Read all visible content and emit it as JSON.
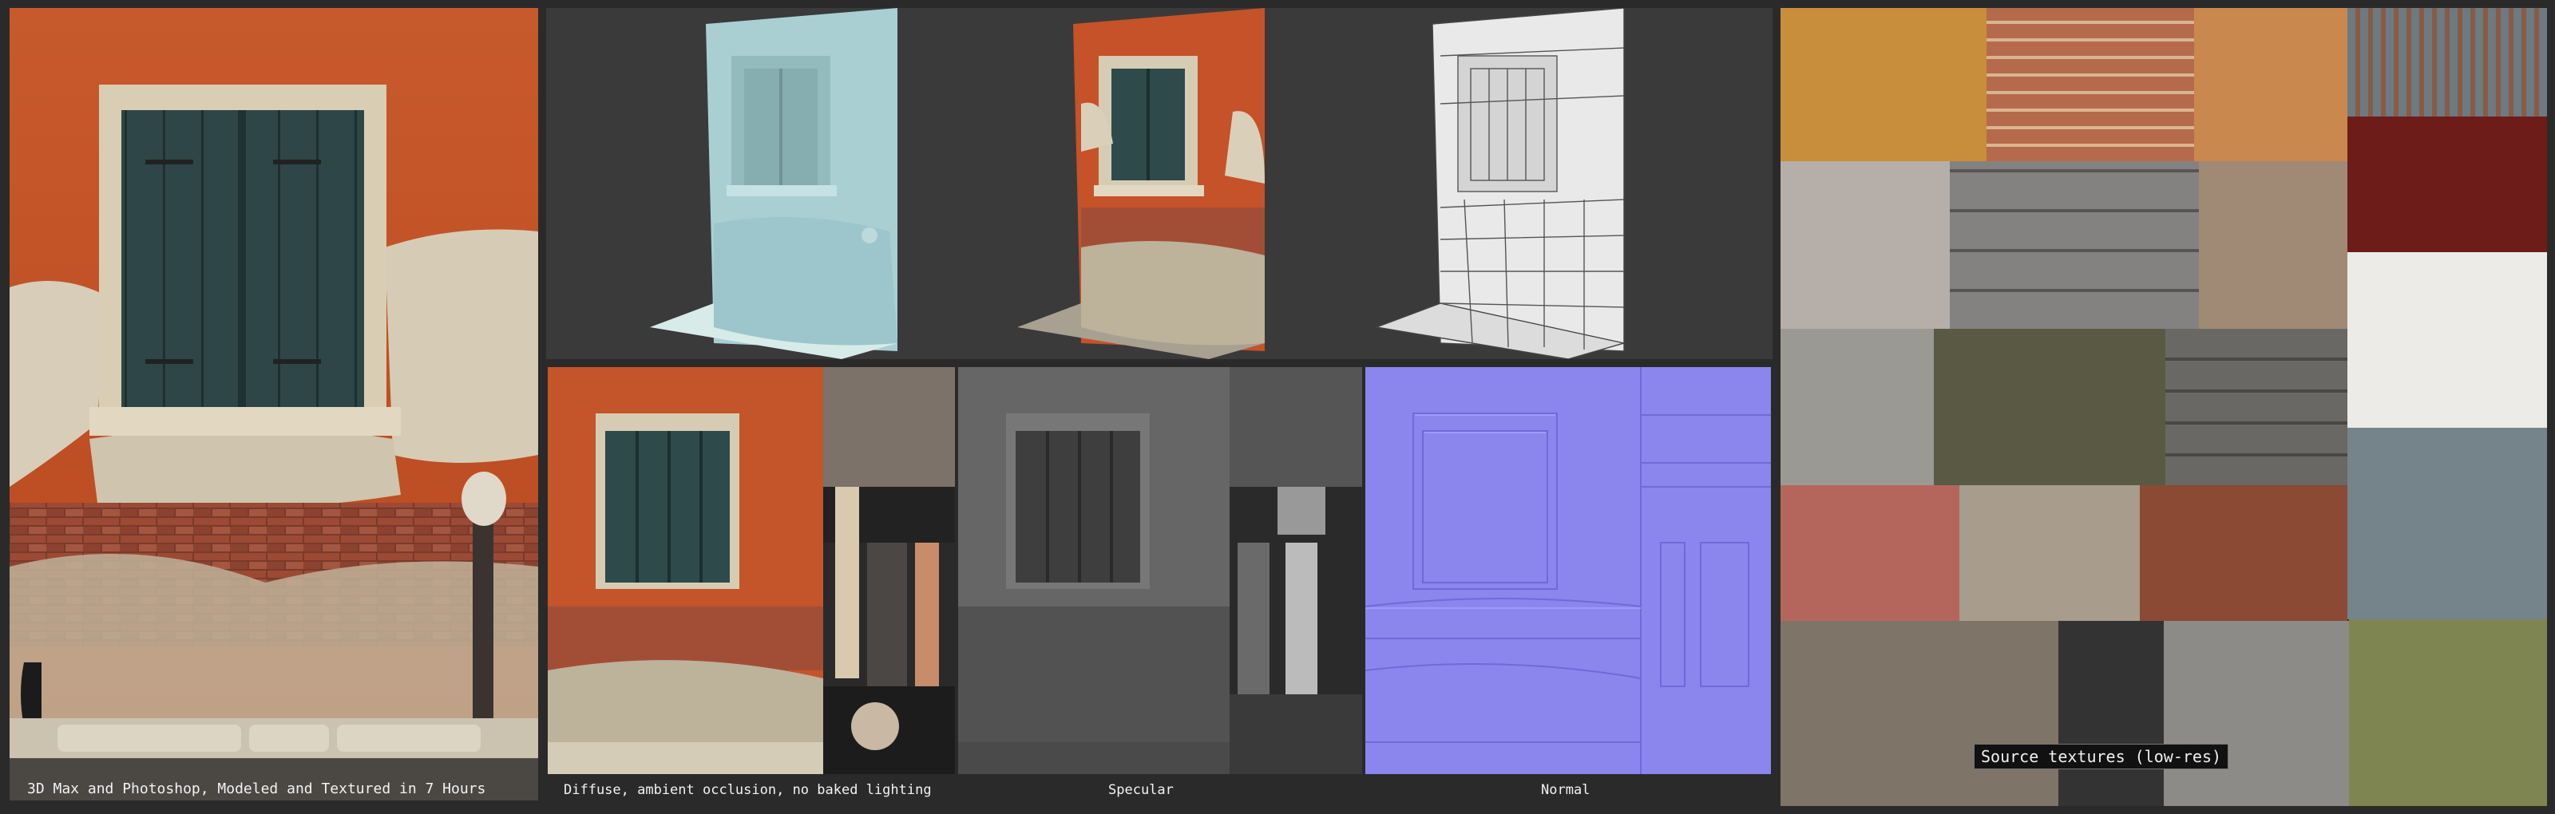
{
  "captions": {
    "hero": "3D Max and Photoshop, Modeled and Textured in 7 Hours",
    "diffuse": "Diffuse, ambient occlusion, no baked lighting",
    "specular": "Specular",
    "normal": "Normal",
    "sources": "Source textures (low-res)"
  },
  "colors": {
    "background": "#2a2a2a",
    "plaster_orange": "#c4542a",
    "shutter_teal": "#2f4a4b",
    "clay_blue": "#a9cfd3",
    "normal_map": "#8a86ee"
  },
  "images": [
    "hero-render",
    "clay-render",
    "textured-render",
    "wireframe-render",
    "diffuse-map",
    "specular-map",
    "normal-map",
    "source-textures"
  ]
}
